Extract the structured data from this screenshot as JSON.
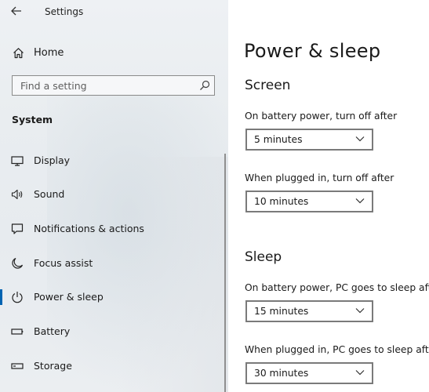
{
  "window": {
    "title": "Settings"
  },
  "sidebar": {
    "home_label": "Home",
    "search_placeholder": "Find a setting",
    "section": "System",
    "items": [
      {
        "label": "Display",
        "icon": "monitor-icon"
      },
      {
        "label": "Sound",
        "icon": "speaker-icon"
      },
      {
        "label": "Notifications & actions",
        "icon": "notification-icon"
      },
      {
        "label": "Focus assist",
        "icon": "moon-icon"
      },
      {
        "label": "Power & sleep",
        "icon": "power-icon",
        "selected": true
      },
      {
        "label": "Battery",
        "icon": "battery-icon"
      },
      {
        "label": "Storage",
        "icon": "storage-icon"
      }
    ]
  },
  "main": {
    "title": "Power & sleep",
    "screen": {
      "heading": "Screen",
      "battery_label": "On battery power, turn off after",
      "battery_value": "5 minutes",
      "plugged_label": "When plugged in, turn off after",
      "plugged_value": "10 minutes"
    },
    "sleep": {
      "heading": "Sleep",
      "battery_label": "On battery power, PC goes to sleep after",
      "battery_value": "15 minutes",
      "plugged_label": "When plugged in, PC goes to sleep after",
      "plugged_value": "30 minutes"
    }
  },
  "colors": {
    "accent": "#0063b1",
    "text": "#1a1a1a",
    "border": "#7a7a7a"
  }
}
